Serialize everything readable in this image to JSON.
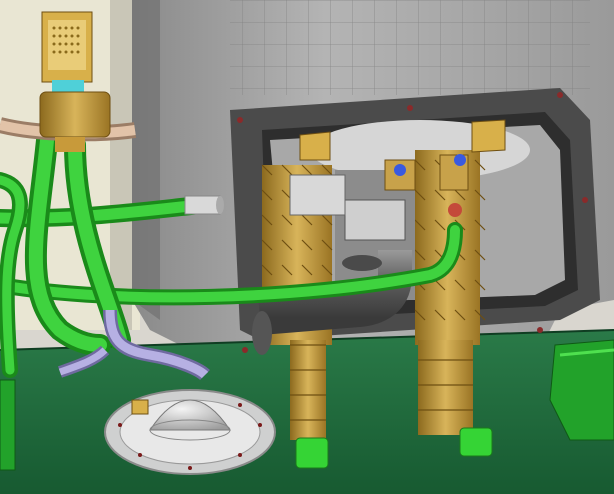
{
  "scene": {
    "colors": {
      "wall": "#e8e5d4",
      "panel_gray": "#9a9a9a",
      "panel_dark": "#5e5e5e",
      "floor_green": "#1f6b3d",
      "hose_green": "#2fbf2f",
      "brass": "#c8a24a",
      "brass_dark": "#7a5a16",
      "steel": "#c9c9c9",
      "pipe_gray": "#6f6f6f",
      "hose_lavender": "#a9a3d6",
      "copper_tube": "#d8b79a",
      "yellow_connector": "#d8b04a"
    },
    "icons": [
      "electrical-connector-icon",
      "mounting-bolt-icon"
    ]
  }
}
